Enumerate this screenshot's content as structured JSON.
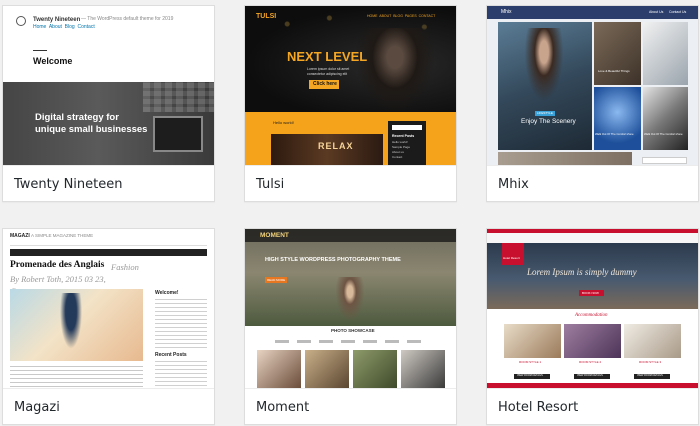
{
  "themes": [
    {
      "name": "Twenty Nineteen",
      "preview": {
        "site_title": "Twenty Nineteen",
        "tagline": "— The WordPress default theme for 2019",
        "nav": "Home  About  Blog  Contact",
        "welcome": "Welcome",
        "hero_line1": "Digital strategy for",
        "hero_line2": "unique small businesses"
      }
    },
    {
      "name": "Tulsi",
      "preview": {
        "brand": "TULSI",
        "menu": "HOME  ABOUT  BLOG  PAGES  CONTACT",
        "headline": "NEXT LEVEL",
        "blurb_1": "Lorem ipsum dolor sit amet",
        "blurb_2": "consectetur adipiscing elit",
        "button": "Click here",
        "post_title": "Hello world!",
        "sidebar_title": "Recent Posts",
        "sidebar_items": [
          "Hello world!",
          "Sample Page",
          "About us",
          "Contact"
        ],
        "neon_sign": "RELAX"
      }
    },
    {
      "name": "Mhix",
      "preview": {
        "brand": "Mhix",
        "menu_1": "About Us",
        "menu_2": "Contact Us",
        "featured_title": "Enjoy The Scenery",
        "tag": "LIFESTYLE",
        "tile_1": "Love & Beautiful Things",
        "tile_2": "Walk Out Of The Comfort Zone",
        "tile_3": "Walk Out Of The Comfort Zone"
      }
    },
    {
      "name": "Magazi",
      "preview": {
        "brand": "MAGAZI",
        "brand_sub": "A SIMPLE MAGAZINE THEME",
        "post_title": "Promenade des Anglais",
        "post_meta": "Fashion By Robert Toth, 2015 03 23, Comment»",
        "sidebar_welcome": "Welcome!",
        "sidebar_recent": "Recent Posts"
      }
    },
    {
      "name": "Moment",
      "preview": {
        "brand": "MOMENT",
        "headline": "HIGH STYLE WORDPRESS PHOTOGRAPHY THEME",
        "button": "READ MORE",
        "section_title": "PHOTO SHOWCASE"
      }
    },
    {
      "name": "Hotel Resort",
      "preview": {
        "brand": "Hotel Resort",
        "headline": "Lorem Ipsum is simply dummy",
        "button": "BOOK NOW",
        "section_title": "Accommodation",
        "room_1": "ROOM STYLE 1",
        "room_2": "ROOM STYLE 2",
        "room_3": "ROOM STYLE 3",
        "room_button": "VIEW ROOM DETAILS"
      }
    }
  ]
}
